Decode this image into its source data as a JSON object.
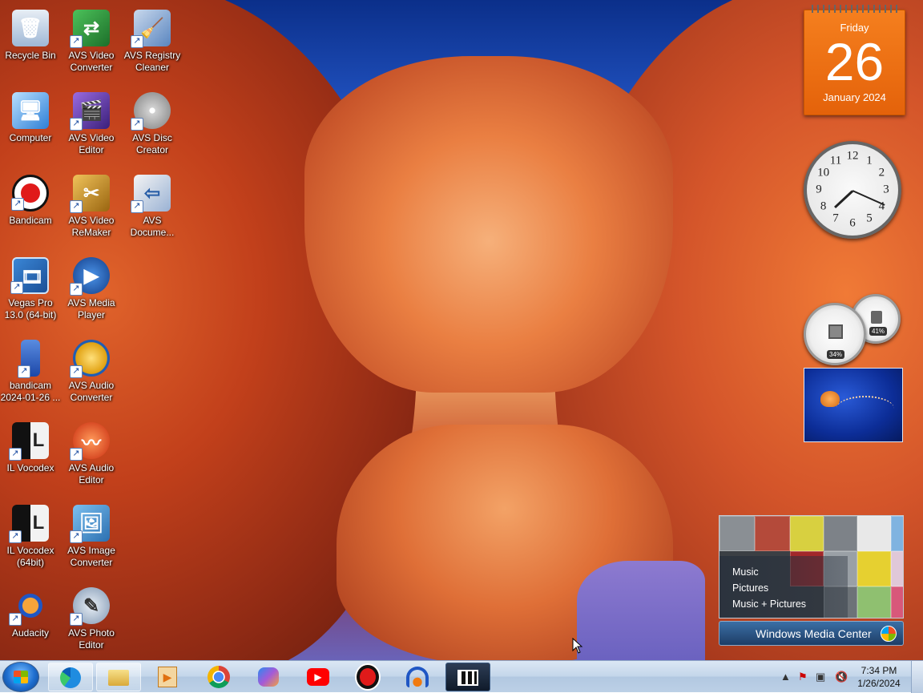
{
  "desktop_icons": [
    {
      "label": "Recycle Bin",
      "icon": "recycle-bin-icon",
      "color": "#9fb8d6"
    },
    {
      "label": "Computer",
      "icon": "computer-icon",
      "color": "#4aa3e8"
    },
    {
      "label": "Bandicam",
      "icon": "bandicam-icon",
      "color": "#e01a1a"
    },
    {
      "label": "Vegas Pro\n13.0 (64-bit)",
      "icon": "vegas-pro-icon",
      "color": "#2b6fb7"
    },
    {
      "label": "bandicam\n2024-01-26 ...",
      "icon": "video-file-icon",
      "color": "#2e63c7"
    },
    {
      "label": "IL Vocodex",
      "icon": "il-vocodex-icon",
      "color": "#3a3a3a"
    },
    {
      "label": "IL Vocodex\n(64bit)",
      "icon": "il-vocodex-64-icon",
      "color": "#3a3a3a"
    },
    {
      "label": "Audacity",
      "icon": "audacity-icon",
      "color": "#f07a10"
    },
    {
      "label": "AVS Video\nConverter",
      "icon": "avs-video-converter-icon",
      "color": "#2f9a3a"
    },
    {
      "label": "AVS Video\nEditor",
      "icon": "avs-video-editor-icon",
      "color": "#6a3fb0"
    },
    {
      "label": "AVS Video\nReMaker",
      "icon": "avs-video-remaker-icon",
      "color": "#d49a1c"
    },
    {
      "label": "AVS Media\nPlayer",
      "icon": "avs-media-player-icon",
      "color": "#1f5db5"
    },
    {
      "label": "AVS Audio\nConverter",
      "icon": "avs-audio-converter-icon",
      "color": "#e7a81d"
    },
    {
      "label": "AVS Audio\nEditor",
      "icon": "avs-audio-editor-icon",
      "color": "#e24b1f"
    },
    {
      "label": "AVS Image\nConverter",
      "icon": "avs-image-converter-icon",
      "color": "#2f7fc0"
    },
    {
      "label": "AVS Photo\nEditor",
      "icon": "avs-photo-editor-icon",
      "color": "#8aa0b8"
    },
    {
      "label": "AVS Registry\nCleaner",
      "icon": "avs-registry-cleaner-icon",
      "color": "#5a86c0"
    },
    {
      "label": "AVS Disc\nCreator",
      "icon": "avs-disc-creator-icon",
      "color": "#c8c8c8"
    },
    {
      "label": "AVS\nDocume...",
      "icon": "avs-document-converter-icon",
      "color": "#3a6fb8"
    }
  ],
  "calendar": {
    "weekday": "Friday",
    "day": "26",
    "month_year": "January 2024",
    "color": "#f07018"
  },
  "clock": {
    "numbers": [
      "12",
      "1",
      "2",
      "3",
      "4",
      "5",
      "6",
      "7",
      "8",
      "9",
      "10",
      "11"
    ],
    "hour_angle": 227,
    "minute_angle": 114
  },
  "cpu_meter": {
    "cpu": "34%",
    "memory": "41%"
  },
  "media_center": {
    "menu": [
      "Music",
      "Pictures",
      "Music + Pictures"
    ],
    "title": "Windows Media Center"
  },
  "taskbar": {
    "apps": [
      {
        "name": "edge",
        "icon": "edge-icon",
        "state": "pinned"
      },
      {
        "name": "explorer",
        "icon": "folder-icon",
        "state": "pinned"
      },
      {
        "name": "media-player",
        "icon": "media-player-icon",
        "state": "plain"
      },
      {
        "name": "chrome",
        "icon": "chrome-icon",
        "state": "plain"
      },
      {
        "name": "copilot",
        "icon": "copilot-icon",
        "state": "plain"
      },
      {
        "name": "youtube",
        "icon": "youtube-icon",
        "state": "plain"
      },
      {
        "name": "bandicam",
        "icon": "record-icon",
        "state": "plain"
      },
      {
        "name": "audacity",
        "icon": "audacity-headphones-icon",
        "state": "plain"
      },
      {
        "name": "vegas",
        "icon": "film-icon",
        "state": "active"
      }
    ],
    "time": "7:34 PM",
    "date": "1/26/2024"
  }
}
